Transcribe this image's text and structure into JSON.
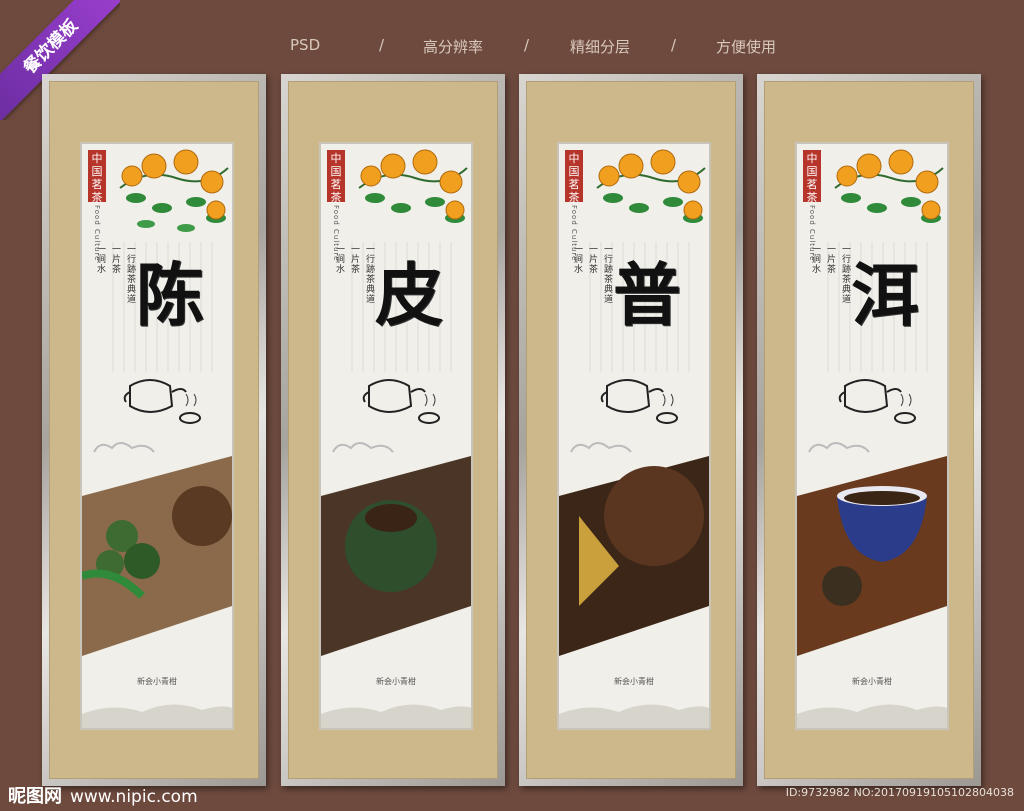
{
  "ribbon": {
    "label": "餐饮模板",
    "color": "#8e3cc8"
  },
  "topbar": {
    "items": [
      "PSD",
      "/",
      "高分辨率",
      "/",
      "精细分层",
      "/",
      "方便使用"
    ]
  },
  "panels": [
    {
      "char": "陈",
      "verse": [
        "一涧水",
        "一片茶",
        "一行跡茶典道"
      ],
      "caption": "新会小青柑",
      "seal": "中国茗茶",
      "seal_en": "Food Culture",
      "photo": "limes"
    },
    {
      "char": "皮",
      "verse": [
        "一涧水",
        "一片茶",
        "一行跡茶典道"
      ],
      "caption": "新会小青柑",
      "seal": "中国茗茶",
      "seal_en": "Food Culture",
      "photo": "green-citrus"
    },
    {
      "char": "普",
      "verse": [
        "一涧水",
        "一片茶",
        "一行跡茶典道"
      ],
      "caption": "新会小青柑",
      "seal": "中国茗茶",
      "seal_en": "Food Culture",
      "photo": "puer-leaves"
    },
    {
      "char": "洱",
      "verse": [
        "一涧水",
        "一片茶",
        "一行跡茶典道"
      ],
      "caption": "新会小青柑",
      "seal": "中国茗茶",
      "seal_en": "Food Culture",
      "photo": "tea-cup"
    }
  ],
  "footer": {
    "brand": "昵图网",
    "url": "www.nipic.com",
    "id_text": "ID:9732982 NO:20170919105102804038"
  },
  "colors": {
    "background": "#6e4a3e",
    "mat": "#cdb88c",
    "seal": "#b7342a",
    "orange": "#f0a01e",
    "leaf": "#2f8a3a"
  }
}
